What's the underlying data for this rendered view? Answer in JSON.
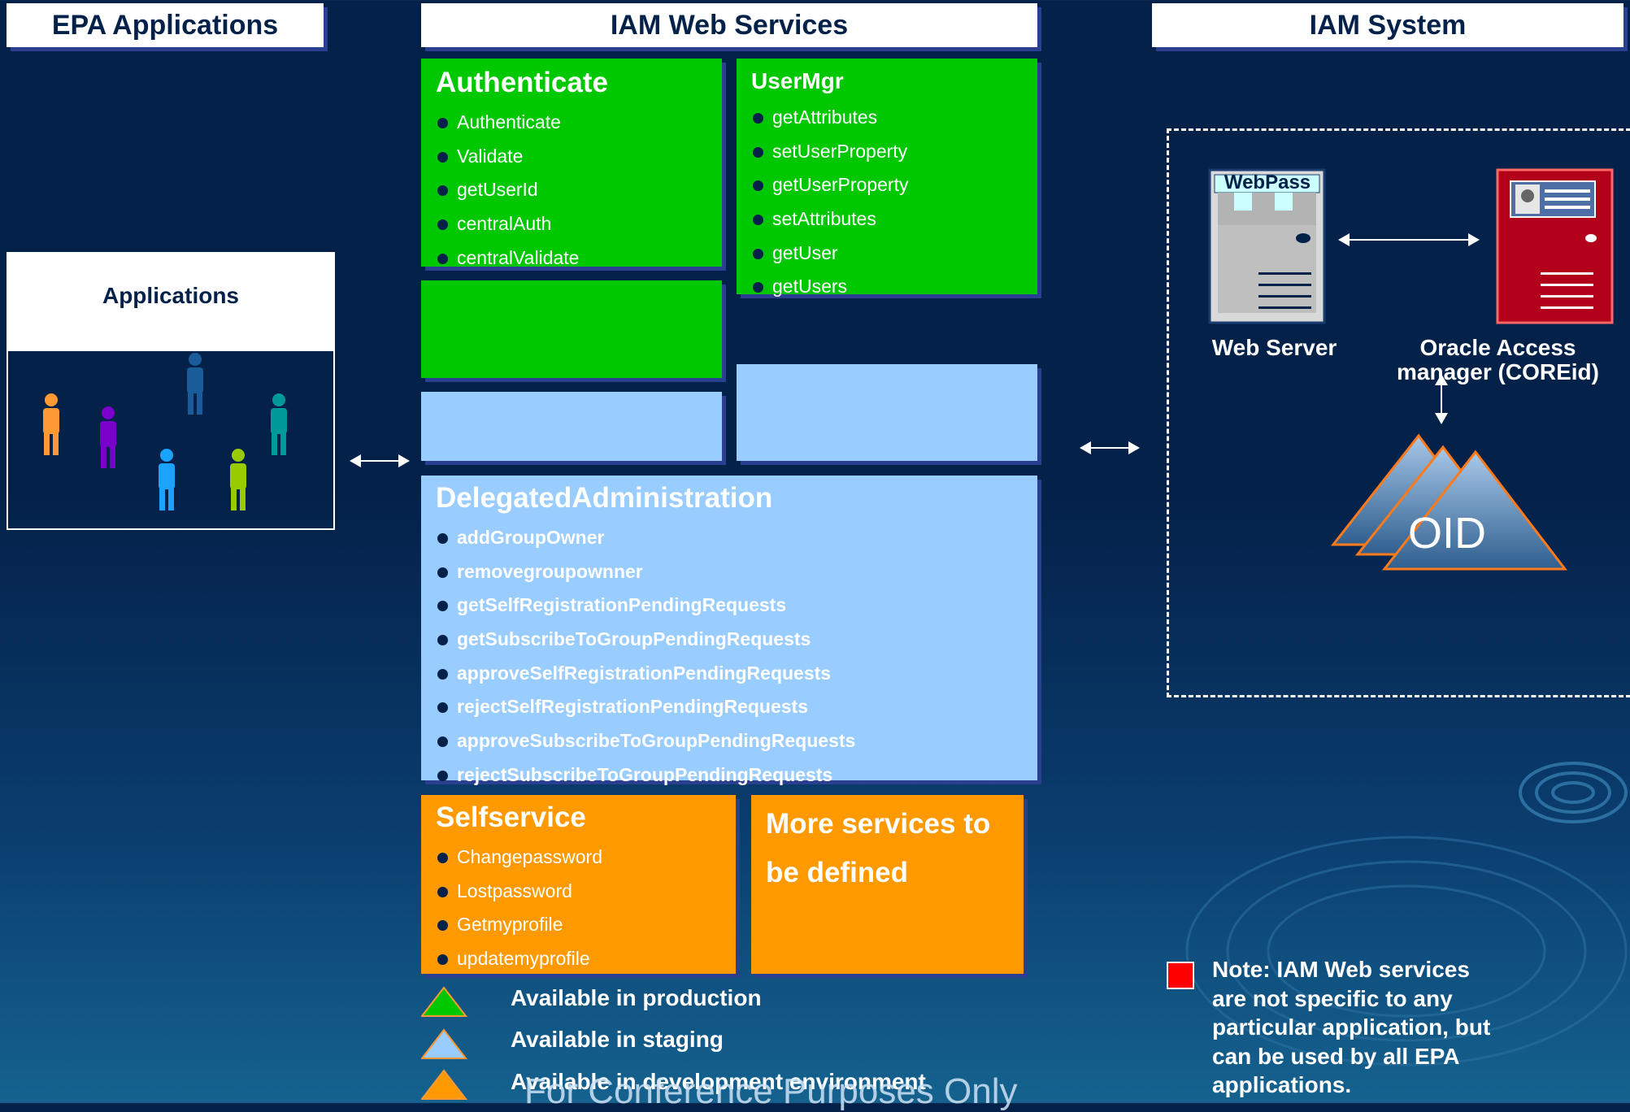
{
  "headers": {
    "epa": "EPA Applications",
    "iam_ws": "IAM Web Services",
    "iam_sys": "IAM System"
  },
  "applications": {
    "title": "Applications"
  },
  "authenticate": {
    "title": "Authenticate",
    "items": [
      "Authenticate",
      "Validate",
      "getUserId",
      "centralAuth",
      "centralValidate"
    ]
  },
  "usermgr": {
    "title": "UserMgr",
    "items": [
      "getAttributes",
      "setUserProperty",
      "getUserProperty",
      "setAttributes",
      "getUser",
      "getUsers"
    ]
  },
  "delegated": {
    "title": "DelegatedAdministration",
    "items": [
      "addGroupOwner",
      "removegroupownner",
      "getSelfRegistrationPendingRequests",
      "getSubscribeToGroupPendingRequests",
      "approveSelfRegistrationPendingRequests",
      "rejectSelfRegistrationPendingRequests",
      "approveSubscribeToGroupPendingRequests",
      "rejectSubscribeToGroupPendingRequests"
    ]
  },
  "selfservice": {
    "title": "Selfservice",
    "items": [
      "Changepassword",
      "Lostpassword",
      "Getmyprofile",
      "updatemyprofile"
    ]
  },
  "more": {
    "line1": "More services to",
    "line2": "be defined"
  },
  "system": {
    "webpass": "WebPass",
    "webserver": "Web Server",
    "oam_line1": "Oracle Access",
    "oam_line2": "manager (COREid)",
    "oid": "OID"
  },
  "legend": {
    "production": "Available in production",
    "staging": "Available in staging",
    "development": "Available in development environment"
  },
  "note": {
    "lines": [
      "Note: IAM Web services",
      "are not specific to any",
      "particular application, but",
      "can be used by all EPA",
      "applications."
    ]
  },
  "footer": "For Conference Purposes Only",
  "colors": {
    "background": "#04214a",
    "production": "#00c800",
    "staging": "#99ccff",
    "development": "#ff9900",
    "note_marker": "#ff0000"
  }
}
